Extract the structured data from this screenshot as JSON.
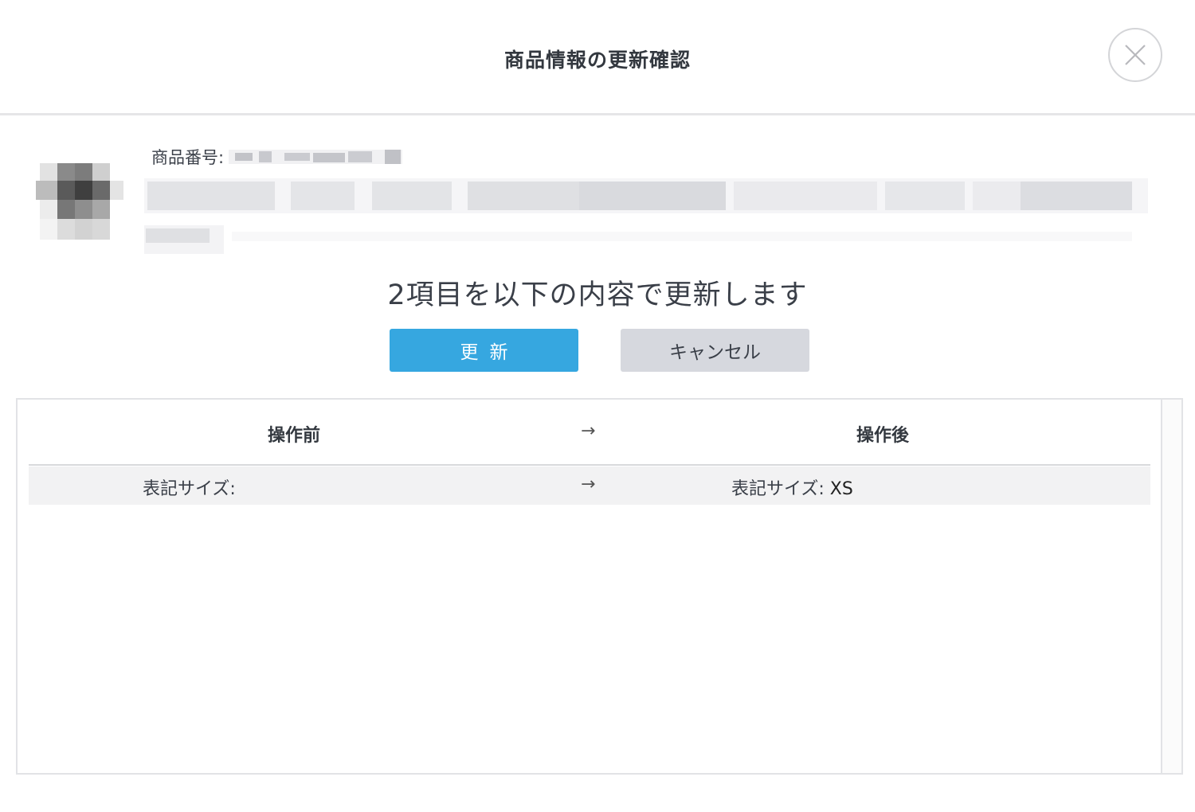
{
  "modal": {
    "title": "商品情報の更新確認",
    "close_icon": "close-icon"
  },
  "product": {
    "number_label": "商品番号:"
  },
  "message": "2項目を以下の内容で更新します",
  "buttons": {
    "update": "更新",
    "cancel": "キャンセル"
  },
  "table": {
    "headers": {
      "before": "操作前",
      "arrow": "→",
      "after": "操作後"
    },
    "rows": [
      {
        "before_label": "表記サイズ:",
        "before_value": "",
        "arrow": "→",
        "after_label": "表記サイズ:",
        "after_value": "XS"
      }
    ]
  },
  "colors": {
    "primary": "#36a7e0",
    "secondary": "#d6d8de",
    "row_bg": "#f2f2f3"
  }
}
